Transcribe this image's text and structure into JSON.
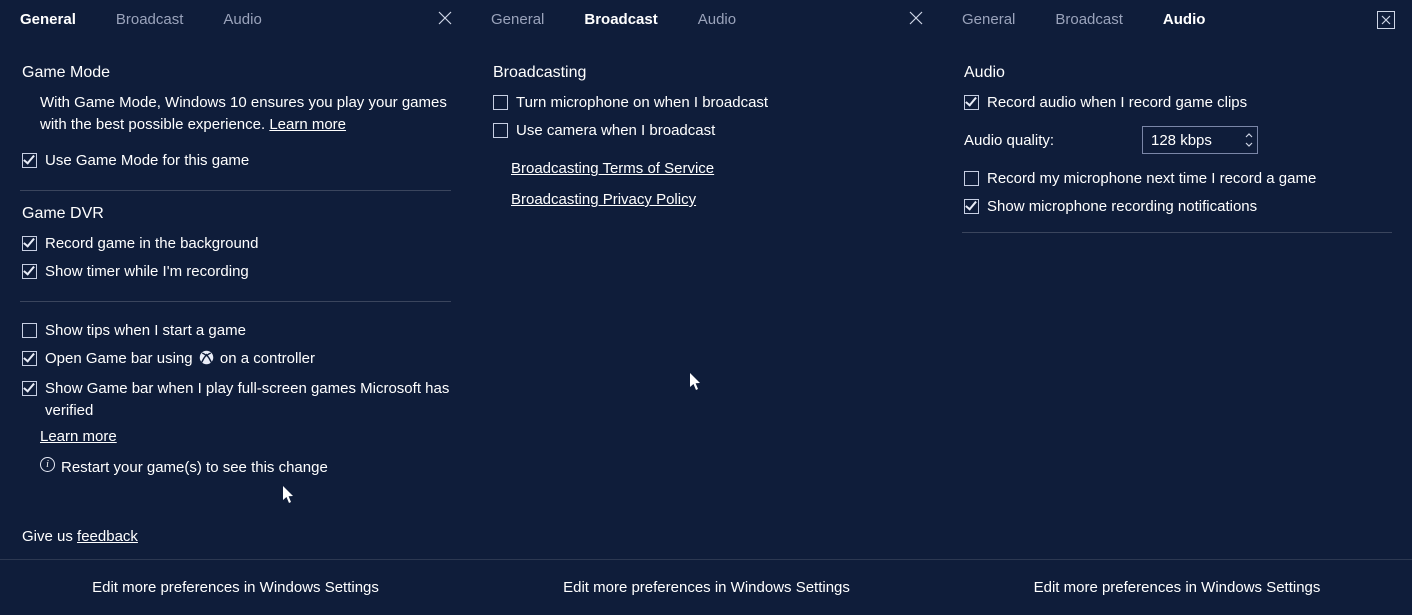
{
  "tabs": {
    "general": "General",
    "broadcast": "Broadcast",
    "audio": "Audio"
  },
  "footer": "Edit more preferences in Windows Settings",
  "general": {
    "gameModeTitle": "Game Mode",
    "gameModeDesc": "With Game Mode, Windows 10 ensures you play your games with the best possible experience. ",
    "learnMore": "Learn more",
    "useGameMode": "Use Game Mode for this game",
    "dvrTitle": "Game DVR",
    "recordBg": "Record game in the background",
    "showTimer": "Show timer while I'm recording",
    "showTips": "Show tips when I start a game",
    "openGameBarPre": "Open Game bar using ",
    "openGameBarPost": " on a controller",
    "fullscreen": "Show Game bar when I play full-screen games Microsoft has verified",
    "restartNote": "Restart your game(s) to see this change",
    "giveUs": "Give us ",
    "feedbackWord": "feedback"
  },
  "broadcast": {
    "title": "Broadcasting",
    "micOn": "Turn microphone on when I broadcast",
    "camOn": "Use camera when I broadcast",
    "tos": "Broadcasting Terms of Service",
    "privacy": "Broadcasting Privacy Policy"
  },
  "audio": {
    "title": "Audio",
    "recordAudio": "Record audio when I record game clips",
    "qualityLabel": "Audio quality:",
    "qualityValue": "128 kbps",
    "recordMic": "Record my microphone next time I record a game",
    "showMicNotif": "Show microphone recording notifications"
  }
}
